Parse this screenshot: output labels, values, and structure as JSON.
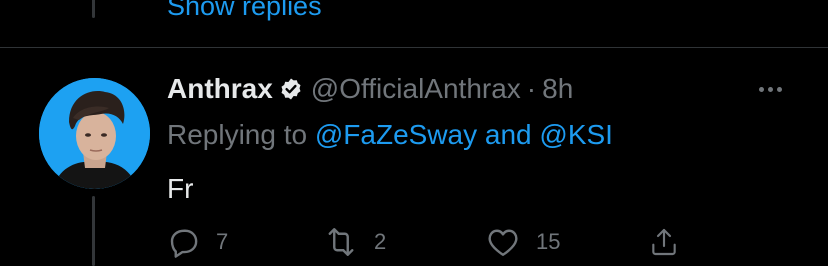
{
  "thread": {
    "show_replies_label": "Show replies"
  },
  "tweet": {
    "display_name": "Anthrax",
    "verified": true,
    "handle": "@OfficialAnthrax",
    "separator": "·",
    "time": "8h",
    "replying_prefix": "Replying to",
    "replying_user_1": "@FaZeSway",
    "replying_joiner": "and",
    "replying_user_2": "@KSI",
    "text": "Fr",
    "actions": {
      "reply_count": "7",
      "retweet_count": "2",
      "like_count": "15"
    }
  },
  "icons": {
    "avatar": "avatar-photo",
    "verified": "verified-badge-icon",
    "more": "more-options-icon",
    "reply": "reply-icon",
    "retweet": "retweet-icon",
    "like": "heart-icon",
    "share": "share-icon"
  },
  "colors": {
    "background": "#000000",
    "accent": "#1d9bf0",
    "text_primary": "#e7e9ea",
    "text_secondary": "#71767b",
    "avatar_background": "#1da1f2"
  }
}
